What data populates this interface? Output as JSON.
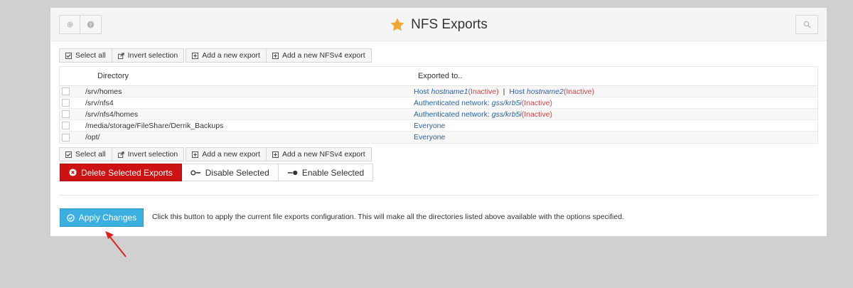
{
  "header": {
    "title": "NFS Exports",
    "left_buttons": [
      {
        "icon": "gear-icon"
      },
      {
        "icon": "question-icon"
      }
    ],
    "right_button": {
      "icon": "search-icon"
    }
  },
  "toolbar": {
    "select_all": "Select all",
    "invert_selection": "Invert selection",
    "add_export": "Add a new export",
    "add_nfsv4_export": "Add a new NFSv4 export"
  },
  "table": {
    "columns": [
      "Directory",
      "Exported to.."
    ],
    "rows": [
      {
        "directory": "/srv/homes",
        "export": [
          {
            "prefix": "Host ",
            "name": "hostname1",
            "status": "(Inactive)"
          },
          {
            "prefix": "Host ",
            "name": "hostname2",
            "status": "(Inactive)"
          }
        ]
      },
      {
        "directory": "/srv/nfs4",
        "export": [
          {
            "prefix": "Authenticated network: ",
            "name": "gss/krb5i",
            "status": "(Inactive)"
          }
        ]
      },
      {
        "directory": "/srv/nfs4/homes",
        "export": [
          {
            "prefix": "Authenticated network: ",
            "name": "gss/krb5i",
            "status": "(Inactive)"
          }
        ]
      },
      {
        "directory": "/media/storage/FileShare/Derrik_Backups",
        "export": [
          {
            "prefix": "Everyone",
            "name": "",
            "status": ""
          }
        ]
      },
      {
        "directory": "/opt/",
        "export": [
          {
            "prefix": "Everyone",
            "name": "",
            "status": ""
          }
        ]
      }
    ],
    "separator": "|"
  },
  "actions": {
    "delete": "Delete Selected Exports",
    "disable": "Disable Selected",
    "enable": "Enable Selected"
  },
  "apply": {
    "label": "Apply Changes",
    "description": "Click this button to apply the current file exports configuration. This will make all the directories listed above available with the options specified."
  },
  "colors": {
    "danger": "#cc1212",
    "primary": "#3bb0e0",
    "link": "#2a62a8",
    "inactive": "#d64040",
    "star": "#f0a830",
    "annotation_arrow": "#e02020"
  }
}
